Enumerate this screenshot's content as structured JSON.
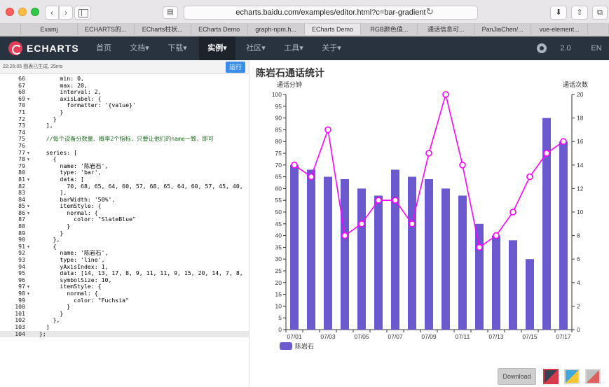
{
  "browser": {
    "url": "echarts.baidu.com/examples/editor.html?c=bar-gradient",
    "tabs": [
      "",
      "Examj",
      "ECHARTS的...",
      "ECharts柱状...",
      "ECharts Demo",
      "graph-npm.h...",
      "ECharts Demo",
      "RGB颜色值...",
      "通话信息可...",
      "PanJiaChen/...",
      "vue-element...",
      ""
    ],
    "active_tab": 6
  },
  "nav": {
    "brand": "ECHARTS",
    "items": [
      "首页",
      "文档▾",
      "下载▾",
      "实例▾",
      "社区▾",
      "工具▾",
      "关于▾"
    ],
    "active": 3,
    "version": "2.0",
    "lang": "EN"
  },
  "editor": {
    "status": "22:26:05  图表已生成, 25ms",
    "run_label": "运行",
    "lines": [
      {
        "n": "66",
        "f": "",
        "t": "        min: 0,"
      },
      {
        "n": "67",
        "f": "",
        "t": "        max: 20,"
      },
      {
        "n": "68",
        "f": "",
        "t": "        interval: 2,"
      },
      {
        "n": "69",
        "f": "▾",
        "t": "        axisLabel: {"
      },
      {
        "n": "70",
        "f": "",
        "t": "          formatter: '{value}'"
      },
      {
        "n": "71",
        "f": "",
        "t": "        }"
      },
      {
        "n": "72",
        "f": "",
        "t": "      }"
      },
      {
        "n": "73",
        "f": "",
        "t": "    ],"
      },
      {
        "n": "74",
        "f": "",
        "t": ""
      },
      {
        "n": "75",
        "f": "",
        "t": "    //每个设备分数量、概率2个指标，只要让他们的name一致，即可"
      },
      {
        "n": "76",
        "f": "",
        "t": ""
      },
      {
        "n": "77",
        "f": "▾",
        "t": "    series: ["
      },
      {
        "n": "78",
        "f": "▾",
        "t": "      {"
      },
      {
        "n": "79",
        "f": "",
        "t": "        name: '陈岩石',"
      },
      {
        "n": "80",
        "f": "",
        "t": "        type: 'bar',"
      },
      {
        "n": "81",
        "f": "▾",
        "t": "        data: ["
      },
      {
        "n": "82",
        "f": "",
        "t": "          70, 68, 65, 64, 60, 57, 68, 65, 64, 60, 57, 45, 40,"
      },
      {
        "n": "83",
        "f": "",
        "t": "        ],"
      },
      {
        "n": "84",
        "f": "",
        "t": "        barWidth: '50%',"
      },
      {
        "n": "85",
        "f": "▾",
        "t": "        itemStyle: {"
      },
      {
        "n": "86",
        "f": "▾",
        "t": "          normal: {"
      },
      {
        "n": "87",
        "f": "",
        "t": "            color: \"SlateBlue\""
      },
      {
        "n": "88",
        "f": "",
        "t": "          }"
      },
      {
        "n": "89",
        "f": "",
        "t": "        }"
      },
      {
        "n": "90",
        "f": "",
        "t": "      },"
      },
      {
        "n": "91",
        "f": "▾",
        "t": "      {"
      },
      {
        "n": "92",
        "f": "",
        "t": "        name: '陈岩石',"
      },
      {
        "n": "93",
        "f": "",
        "t": "        type: 'line',"
      },
      {
        "n": "94",
        "f": "",
        "t": "        yAxisIndex: 1,"
      },
      {
        "n": "95",
        "f": "",
        "t": "        data: [14, 13, 17, 8, 9, 11, 11, 9, 15, 20, 14, 7, 8,"
      },
      {
        "n": "96",
        "f": "",
        "t": "        symbolSize: 10,"
      },
      {
        "n": "97",
        "f": "▾",
        "t": "        itemStyle: {"
      },
      {
        "n": "98",
        "f": "▾",
        "t": "          normal: {"
      },
      {
        "n": "99",
        "f": "",
        "t": "            color: \"Fuchsia\""
      },
      {
        "n": "100",
        "f": "",
        "t": "          }"
      },
      {
        "n": "101",
        "f": "",
        "t": "        }"
      },
      {
        "n": "102",
        "f": "",
        "t": "      },"
      },
      {
        "n": "103",
        "f": "",
        "t": "    ]"
      },
      {
        "n": "104",
        "f": "",
        "t": "  };"
      }
    ],
    "current_line": "104"
  },
  "chart_data": {
    "type": "bar",
    "title": "陈岩石通话统计",
    "categories": [
      "07/01",
      "07/02",
      "07/03",
      "07/04",
      "07/05",
      "07/06",
      "07/07",
      "07/08",
      "07/09",
      "07/10",
      "07/11",
      "07/12",
      "07/13",
      "07/14",
      "07/15",
      "07/16",
      "07/17"
    ],
    "x_tick_labels": [
      "07/01",
      "07/03",
      "07/05",
      "07/07",
      "07/09",
      "07/11",
      "07/13",
      "07/15",
      "07/17"
    ],
    "ylabel": "通话分钟",
    "ylabel_right": "通话次数",
    "ylim": [
      0,
      100
    ],
    "ylim_right": [
      0,
      20
    ],
    "y_ticks": [
      0,
      5,
      10,
      15,
      20,
      25,
      30,
      35,
      40,
      45,
      50,
      55,
      60,
      65,
      70,
      75,
      80,
      85,
      90,
      95,
      100
    ],
    "y_ticks_right": [
      0,
      2,
      4,
      6,
      8,
      10,
      12,
      14,
      16,
      18,
      20
    ],
    "series": [
      {
        "name": "陈岩石",
        "type": "bar",
        "axis": "left",
        "color": "#6a5acd",
        "values": [
          70,
          68,
          65,
          64,
          60,
          57,
          68,
          65,
          64,
          60,
          57,
          45,
          40,
          38,
          30,
          90,
          80
        ]
      },
      {
        "name": "陈岩石",
        "type": "line",
        "axis": "right",
        "color": "#ff00ff",
        "values": [
          14,
          13,
          17,
          8,
          9,
          11,
          11,
          9,
          15,
          20,
          14,
          7,
          8,
          10,
          13,
          15,
          16
        ]
      }
    ],
    "legend": "陈岩石",
    "grid": false
  },
  "toolbar": {
    "download_label": "Download"
  }
}
